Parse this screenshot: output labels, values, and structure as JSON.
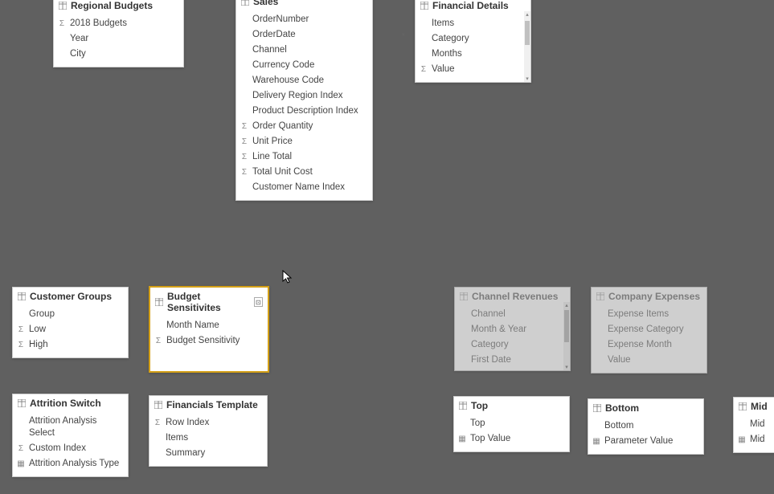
{
  "tables": {
    "regionalBudgets": {
      "title": "Regional Budgets",
      "fields": [
        {
          "icon": "sigma",
          "label": "2018 Budgets"
        },
        {
          "icon": "none",
          "label": "Year"
        },
        {
          "icon": "none",
          "label": "City"
        }
      ]
    },
    "sales": {
      "title": "Sales",
      "fields": [
        {
          "icon": "none",
          "label": "OrderNumber"
        },
        {
          "icon": "none",
          "label": "OrderDate"
        },
        {
          "icon": "none",
          "label": "Channel"
        },
        {
          "icon": "none",
          "label": "Currency Code"
        },
        {
          "icon": "none",
          "label": "Warehouse Code"
        },
        {
          "icon": "none",
          "label": "Delivery Region Index"
        },
        {
          "icon": "none",
          "label": "Product Description Index"
        },
        {
          "icon": "sigma",
          "label": "Order Quantity"
        },
        {
          "icon": "sigma",
          "label": "Unit Price"
        },
        {
          "icon": "sigma",
          "label": "Line Total"
        },
        {
          "icon": "sigma",
          "label": "Total Unit Cost"
        },
        {
          "icon": "none",
          "label": "Customer Name Index"
        }
      ]
    },
    "financialDetails": {
      "title": "Financial Details",
      "fields": [
        {
          "icon": "none",
          "label": "Items"
        },
        {
          "icon": "none",
          "label": "Category"
        },
        {
          "icon": "none",
          "label": "Months"
        },
        {
          "icon": "sigma",
          "label": "Value"
        }
      ]
    },
    "customerGroups": {
      "title": "Customer Groups",
      "fields": [
        {
          "icon": "none",
          "label": "Group"
        },
        {
          "icon": "sigma",
          "label": "Low"
        },
        {
          "icon": "sigma",
          "label": "High"
        }
      ]
    },
    "budgetSensitivities": {
      "title": "Budget Sensitivites",
      "fields": [
        {
          "icon": "none",
          "label": "Month Name"
        },
        {
          "icon": "sigma",
          "label": "Budget Sensitivity"
        }
      ]
    },
    "channelRevenues": {
      "title": "Channel Revenues",
      "fields": [
        {
          "icon": "none",
          "label": "Channel"
        },
        {
          "icon": "none",
          "label": "Month & Year"
        },
        {
          "icon": "none",
          "label": "Category"
        },
        {
          "icon": "none",
          "label": "First Date"
        }
      ]
    },
    "companyExpenses": {
      "title": "Company Expenses",
      "fields": [
        {
          "icon": "none",
          "label": "Expense Items"
        },
        {
          "icon": "none",
          "label": "Expense Category"
        },
        {
          "icon": "none",
          "label": "Expense Month"
        },
        {
          "icon": "none",
          "label": "Value"
        }
      ]
    },
    "attritionSwitch": {
      "title": "Attrition Switch",
      "fields": [
        {
          "icon": "none",
          "label": "Attrition Analysis Select"
        },
        {
          "icon": "sigma",
          "label": "Custom Index"
        },
        {
          "icon": "column",
          "label": "Attrition Analysis Type"
        }
      ]
    },
    "financialsTemplate": {
      "title": "Financials Template",
      "fields": [
        {
          "icon": "sigma",
          "label": "Row Index"
        },
        {
          "icon": "none",
          "label": "Items"
        },
        {
          "icon": "none",
          "label": "Summary"
        }
      ]
    },
    "top": {
      "title": "Top",
      "fields": [
        {
          "icon": "none",
          "label": "Top"
        },
        {
          "icon": "column",
          "label": "Top Value"
        }
      ]
    },
    "bottom": {
      "title": "Bottom",
      "fields": [
        {
          "icon": "none",
          "label": "Bottom"
        },
        {
          "icon": "column",
          "label": "Parameter Value"
        }
      ]
    },
    "mid": {
      "title": "Mid",
      "fields": [
        {
          "icon": "none",
          "label": "Mid"
        },
        {
          "icon": "column",
          "label": "Mid"
        }
      ]
    }
  }
}
